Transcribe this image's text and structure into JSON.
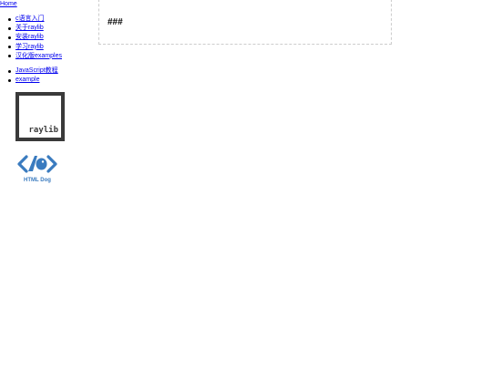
{
  "nav": {
    "home": "Home",
    "section1": [
      "c语言入门",
      "关于raylib",
      "安装raylib",
      "学习raylib",
      "汉化版examples"
    ],
    "section2": [
      "JavaScript教程",
      "example"
    ]
  },
  "content": {
    "heading": "###"
  },
  "logos": {
    "raylib": "raylib",
    "htmldog": "HTML Dog"
  },
  "colors": {
    "link": "#0000ee",
    "htmldog_blue": "#3a7bbf",
    "raylib_dark": "#3a3a3a"
  }
}
